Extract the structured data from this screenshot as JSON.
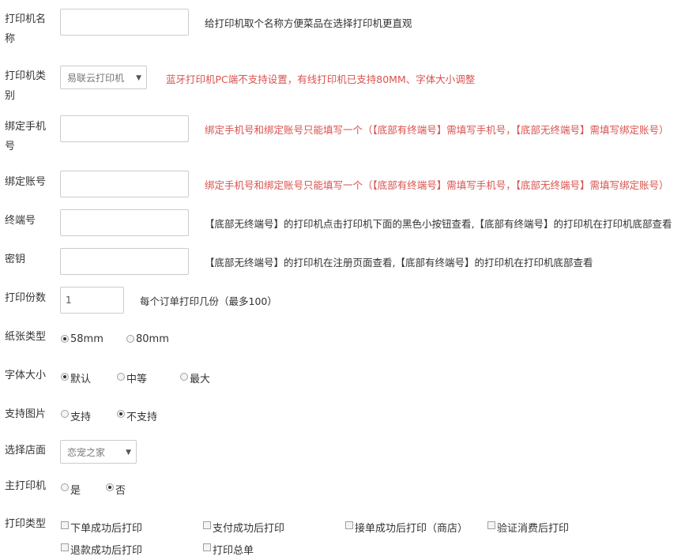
{
  "form": {
    "name": {
      "label_l1": "打印机名",
      "label_l2": "称",
      "value": "",
      "help": "给打印机取个名称方便菜品在选择打印机更直观"
    },
    "type": {
      "label_l1": "打印机类",
      "label_l2": "别",
      "selected": "易联云打印机",
      "help": "蓝牙打印机PC端不支持设置，有线打印机已支持80MM、字体大小调整"
    },
    "phone": {
      "label_l1": "绑定手机",
      "label_l2": "号",
      "value": "",
      "help": "绑定手机号和绑定账号只能填写一个（【底部有终端号】需填写手机号，【底部无终端号】需填写绑定账号）"
    },
    "account": {
      "label": "绑定账号",
      "value": "",
      "help": "绑定手机号和绑定账号只能填写一个（【底部有终端号】需填写手机号，【底部无终端号】需填写绑定账号）"
    },
    "terminal": {
      "label": "终端号",
      "value": "",
      "help": "【底部无终端号】的打印机点击打印机下面的黑色小按钮查看,【底部有终端号】的打印机在打印机底部查看"
    },
    "key": {
      "label": "密钥",
      "value": "",
      "help": "【底部无终端号】的打印机在注册页面查看,【底部有终端号】的打印机在打印机底部查看"
    },
    "copies": {
      "label": "打印份数",
      "value": "1",
      "help": "每个订单打印几份（最多100）"
    },
    "paper": {
      "label": "纸张类型",
      "options": [
        "58mm",
        "80mm"
      ],
      "selected": "58mm"
    },
    "font_size": {
      "label": "字体大小",
      "options": [
        "默认",
        "中等",
        "最大"
      ],
      "selected": "默认"
    },
    "image": {
      "label": "支持图片",
      "options": [
        "支持",
        "不支持"
      ],
      "selected": "不支持"
    },
    "store": {
      "label": "选择店面",
      "selected": "恋宠之家"
    },
    "main_printer": {
      "label": "主打印机",
      "options": [
        "是",
        "否"
      ],
      "selected": "否"
    },
    "print_type": {
      "label": "打印类型",
      "options": [
        "下单成功后打印",
        "支付成功后打印",
        "接单成功后打印（商店）",
        "验证消费后打印",
        "退款成功后打印",
        "打印总单"
      ]
    }
  },
  "colors": {
    "warning": "#d9534f",
    "border": "#cccccc"
  },
  "icons": {
    "dropdown": "caret-down-icon"
  }
}
